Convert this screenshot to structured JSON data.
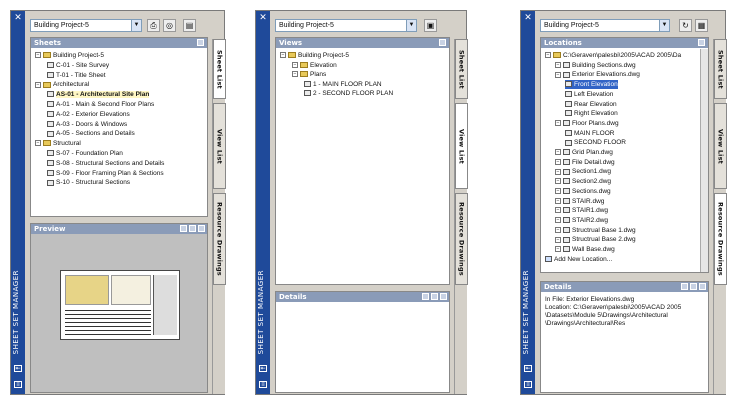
{
  "panel1": {
    "title": "SHEET SET MANAGER",
    "project": "Building Project-5",
    "sheets_header": "Sheets",
    "tree": [
      {
        "label": "Building Project-5",
        "level": 0,
        "kind": "root"
      },
      {
        "label": "C-01 - Site Survey",
        "level": 1,
        "kind": "sheet"
      },
      {
        "label": "T-01 - Title Sheet",
        "level": 1,
        "kind": "sheet"
      },
      {
        "label": "Architectural",
        "level": 0,
        "kind": "folder"
      },
      {
        "label": "AS-01 - Architectural Site Plan",
        "level": 1,
        "kind": "sheet",
        "selected": true
      },
      {
        "label": "A-01 - Main & Second Floor Plans",
        "level": 1,
        "kind": "sheet"
      },
      {
        "label": "A-02 - Exterior Elevations",
        "level": 1,
        "kind": "sheet"
      },
      {
        "label": "A-03 - Doors & Windows",
        "level": 1,
        "kind": "sheet"
      },
      {
        "label": "A-05 - Sections and Details",
        "level": 1,
        "kind": "sheet"
      },
      {
        "label": "Structural",
        "level": 0,
        "kind": "folder"
      },
      {
        "label": "S-07 - Foundation Plan",
        "level": 1,
        "kind": "sheet"
      },
      {
        "label": "S-08 - Structural Sections and Details",
        "level": 1,
        "kind": "sheet"
      },
      {
        "label": "S-09 - Floor Framing Plan & Sections",
        "level": 1,
        "kind": "sheet"
      },
      {
        "label": "S-10 - Structural Sections",
        "level": 1,
        "kind": "sheet"
      }
    ],
    "preview_header": "Preview",
    "tabs": [
      "Sheet List",
      "View List",
      "Resource Drawings"
    ]
  },
  "panel2": {
    "title": "SHEET SET MANAGER",
    "project": "Building Project-5",
    "views_header": "Views",
    "tree": [
      {
        "label": "Building Project-5",
        "level": 0,
        "kind": "root"
      },
      {
        "label": "Elevation",
        "level": 1,
        "kind": "folder"
      },
      {
        "label": "Plans",
        "level": 1,
        "kind": "folder"
      },
      {
        "label": "1 - MAIN FLOOR PLAN",
        "level": 2,
        "kind": "view"
      },
      {
        "label": "2 - SECOND FLOOR PLAN",
        "level": 2,
        "kind": "view"
      }
    ],
    "details_header": "Details",
    "tabs": [
      "Sheet List",
      "View List",
      "Resource Drawings"
    ]
  },
  "panel3": {
    "title": "SHEET SET MANAGER",
    "project": "Building Project-5",
    "locations_header": "Locations",
    "tree": [
      {
        "label": "C:\\Geraven\\palesbi\\2005\\ACAD 2005\\Da",
        "level": 0,
        "kind": "folder"
      },
      {
        "label": "Building Sections.dwg",
        "level": 1,
        "kind": "dwg"
      },
      {
        "label": "Exterior Elevations.dwg",
        "level": 1,
        "kind": "dwg"
      },
      {
        "label": "Front Elevation",
        "level": 2,
        "kind": "view",
        "highlight": true
      },
      {
        "label": "Left Elevation",
        "level": 2,
        "kind": "view"
      },
      {
        "label": "Rear Elevation",
        "level": 2,
        "kind": "view"
      },
      {
        "label": "Right Elevation",
        "level": 2,
        "kind": "view"
      },
      {
        "label": "Floor Plans.dwg",
        "level": 1,
        "kind": "dwg"
      },
      {
        "label": "MAIN FLOOR",
        "level": 2,
        "kind": "view"
      },
      {
        "label": "SECOND FLOOR",
        "level": 2,
        "kind": "view"
      },
      {
        "label": "Grid Plan.dwg",
        "level": 1,
        "kind": "dwg"
      },
      {
        "label": "File Detail.dwg",
        "level": 1,
        "kind": "dwg"
      },
      {
        "label": "Section1.dwg",
        "level": 1,
        "kind": "dwg"
      },
      {
        "label": "Section2.dwg",
        "level": 1,
        "kind": "dwg"
      },
      {
        "label": "Sections.dwg",
        "level": 1,
        "kind": "dwg"
      },
      {
        "label": "STAIR.dwg",
        "level": 1,
        "kind": "dwg"
      },
      {
        "label": "STAIR1.dwg",
        "level": 1,
        "kind": "dwg"
      },
      {
        "label": "STAIR2.dwg",
        "level": 1,
        "kind": "dwg"
      },
      {
        "label": "Structrual Base 1.dwg",
        "level": 1,
        "kind": "dwg"
      },
      {
        "label": "Structrual Base 2.dwg",
        "level": 1,
        "kind": "dwg"
      },
      {
        "label": "Wall Base.dwg",
        "level": 1,
        "kind": "dwg"
      },
      {
        "label": "Add New Location...",
        "level": 0,
        "kind": "add"
      }
    ],
    "details_header": "Details",
    "details_text": "In File: Exterior Elevations.dwg\nLocation: C:\\Geraven\\palesbi\\2005\\ACAD 2005\n\\Datasets\\Module 5\\Drawings\\Architectural\n\\Drawings\\Architectural\\Res",
    "tabs": [
      "Sheet List",
      "View List",
      "Resource Drawings"
    ]
  },
  "colors": {
    "titlebar": "#1f4a9a",
    "header": "#8a9bb8",
    "highlight": "#3163c6"
  }
}
